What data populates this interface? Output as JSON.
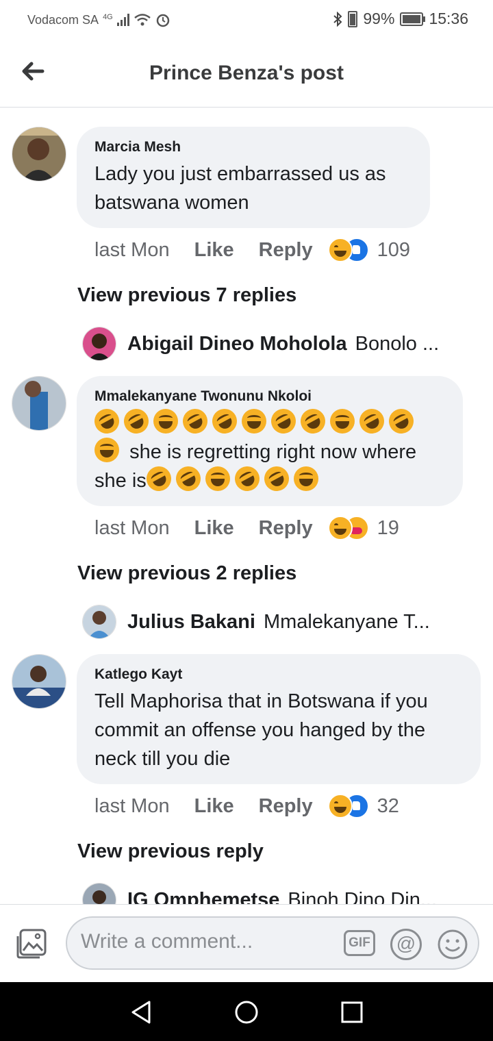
{
  "status_bar": {
    "carrier": "Vodacom SA",
    "network": "4G",
    "battery_percent": "99%",
    "time": "15:36"
  },
  "header": {
    "title": "Prince Benza's post"
  },
  "comments": [
    {
      "author": "Marcia Mesh",
      "text": "Lady you just embarrassed us as batswana women",
      "time": "last Mon",
      "like_label": "Like",
      "reply_label": "Reply",
      "reactions": [
        "haha",
        "like"
      ],
      "reaction_count": "109",
      "view_previous": "View previous 7 replies",
      "latest_reply": {
        "author": "Abigail Dineo Moholola",
        "text": "Bonolo ..."
      }
    },
    {
      "author": "Mmalekanyane Twonunu Nkoloi",
      "text_emoji_lead": 12,
      "text": "she is regretting right now where she is",
      "text_emoji_tail": 6,
      "time": "last Mon",
      "like_label": "Like",
      "reply_label": "Reply",
      "reactions": [
        "haha",
        "care"
      ],
      "reaction_count": "19",
      "view_previous": "View previous 2 replies",
      "latest_reply": {
        "author": "Julius Bakani",
        "text": "Mmalekanyane T..."
      }
    },
    {
      "author": "Katlego Kayt",
      "text": "Tell Maphorisa that in Botswana if you commit an offense you hanged by the neck till you die",
      "time": "last Mon",
      "like_label": "Like",
      "reply_label": "Reply",
      "reactions": [
        "haha",
        "like"
      ],
      "reaction_count": "32",
      "view_previous": "View previous reply",
      "latest_reply": {
        "author": "IG Omphemetse",
        "text": "Binoh Dino Din..."
      }
    }
  ],
  "composer": {
    "placeholder": "Write a comment...",
    "gif_label": "GIF",
    "at_label": "@"
  },
  "colors": {
    "bubble": "#f0f2f5",
    "like_blue": "#1b74e4",
    "haha_yellow": "#f7b125",
    "meta_gray": "#65676b"
  }
}
